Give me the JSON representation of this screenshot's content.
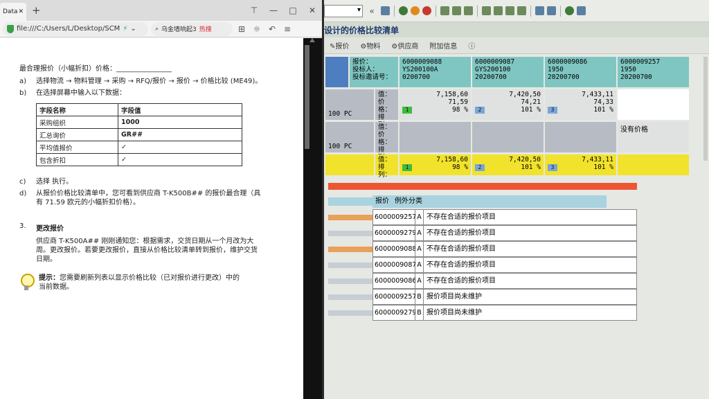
{
  "browser": {
    "tab_label": "Data",
    "address": "file:///C:/Users/L/Desktop/SCM",
    "search_text": "乌金墙响起3",
    "hot_label": "热搜"
  },
  "doc": {
    "intro": "最合理报价（小幅折扣）价格：",
    "steps": [
      {
        "marker": "a)",
        "text": "选择物流 → 物料管理 → 采购 → RFQ/报价 → 报价 → 价格比较 (ME49)。"
      },
      {
        "marker": "b)",
        "text": "在选择屏幕中输入以下数据："
      }
    ],
    "table": {
      "headers": [
        "字段名称",
        "字段值"
      ],
      "rows": [
        [
          "采购组织",
          "1000"
        ],
        [
          "汇总询价",
          "GR##"
        ],
        [
          "平均值报价",
          "✓"
        ],
        [
          "包含折扣",
          "✓"
        ]
      ]
    },
    "steps2": [
      {
        "marker": "c)",
        "text": "选择 执行。"
      },
      {
        "marker": "d)",
        "text": "从报价价格比较清单中，您可看到供应商 T-K500B## 的报价最合理（具有 71.59 欧元的小幅折扣价格）。"
      }
    ],
    "section_number": "3.",
    "section_title": "更改报价",
    "section_text": "供应商 T-K500A## 刚刚通知您：根据需求，交货日期从一个月改为大周。更改报价。若要更改报价，直接从价格比较清单转到报价，维护交货日期。",
    "tip_label": "提示：",
    "tip_text": "您需要刷新列表以显示价格比较（已对报价进行更改）中的当前数据。"
  },
  "sap": {
    "title": "设计的价格比较清单",
    "toolbar_items": [
      "报价",
      "物料",
      "供应商",
      "附加信息"
    ],
    "header_labels": [
      "报价：",
      "投标人：",
      "投标邀请号："
    ],
    "quotes": [
      {
        "quote": "6000009088",
        "bidder": "YS200100A",
        "rfq": "0200700"
      },
      {
        "quote": "6000009087",
        "bidder": "GYS200100",
        "rfq": "20200700"
      },
      {
        "quote": "6000009086",
        "bidder": "1950",
        "rfq": "20200700"
      },
      {
        "quote": "6000009257",
        "bidder": "1950",
        "rfq": "20200700"
      }
    ],
    "qty": "100",
    "unit": "PC",
    "row1_labels": [
      "值：",
      "价格：",
      "排列："
    ],
    "row1": [
      {
        "value": "7,158,60",
        "price": "71,59",
        "rank": "1",
        "pct": "98",
        "pct_unit": "%"
      },
      {
        "value": "7,420,50",
        "price": "74,21",
        "rank": "2",
        "pct": "101",
        "pct_unit": "%"
      },
      {
        "value": "7,433,11",
        "price": "74,33",
        "rank": "3",
        "pct": "101",
        "pct_unit": "%"
      }
    ],
    "row2_labels": [
      "值：",
      "价格：",
      "排列："
    ],
    "no_price": "没有价格",
    "row3_labels": [
      "值：",
      "排列："
    ],
    "row3": [
      {
        "value": "7,158,60",
        "rank": "1",
        "pct": "98",
        "pct_unit": "%"
      },
      {
        "value": "7,420,50",
        "rank": "2",
        "pct": "101",
        "pct_unit": "%"
      },
      {
        "value": "7,433,11",
        "rank": "3",
        "pct": "101",
        "pct_unit": "%"
      }
    ],
    "exceptions_header": [
      "报价",
      "例外分类"
    ],
    "exceptions": [
      {
        "id": "6000009257",
        "cls": "A",
        "msg": "不存在合适的报价项目"
      },
      {
        "id": "6000009279",
        "cls": "A",
        "msg": "不存在合适的报价项目"
      },
      {
        "id": "6000009088",
        "cls": "A",
        "msg": "不存在合适的报价项目"
      },
      {
        "id": "6000009087",
        "cls": "A",
        "msg": "不存在合适的报价项目"
      },
      {
        "id": "6000009086",
        "cls": "A",
        "msg": "不存在合适的报价项目"
      },
      {
        "id": "6000009257",
        "cls": "B",
        "msg": "报价项目尚未维护"
      },
      {
        "id": "6000009279",
        "cls": "B",
        "msg": "报价项目尚未维护"
      }
    ]
  }
}
